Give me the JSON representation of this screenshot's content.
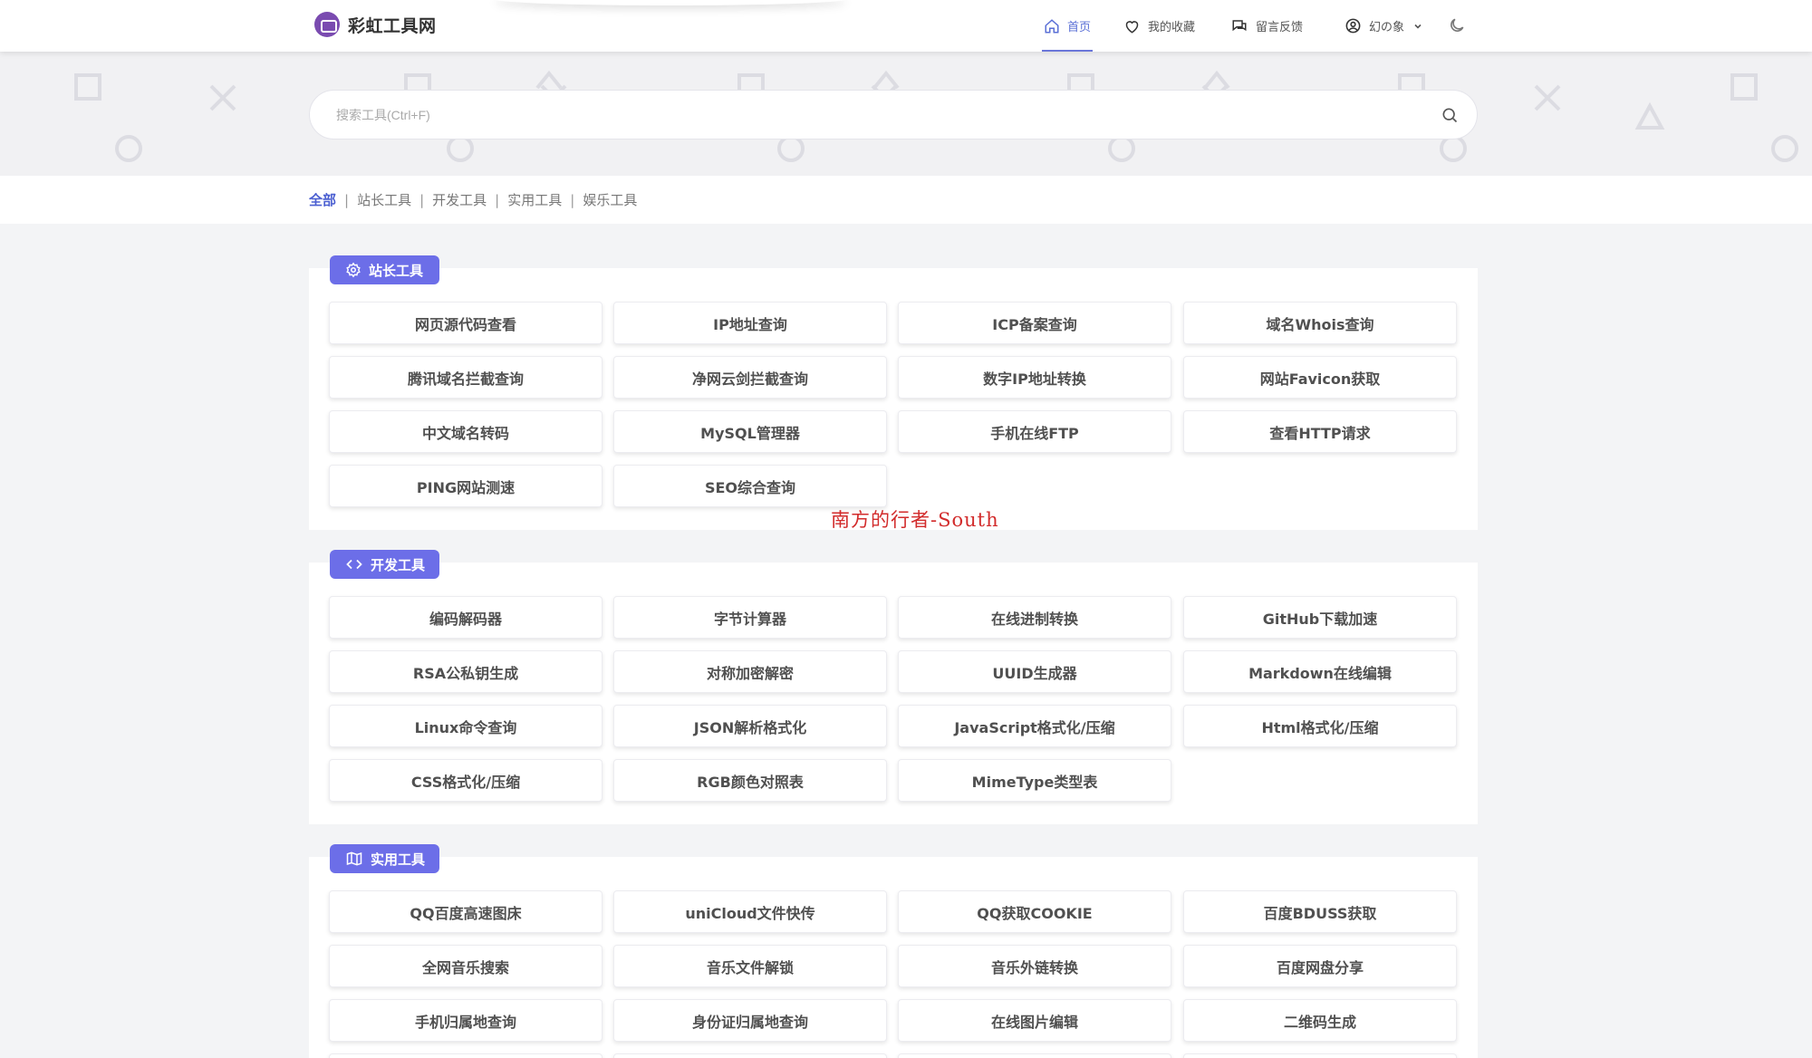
{
  "header": {
    "logo_text": "彩虹工具网",
    "nav": {
      "home": "首页",
      "favorites": "我的收藏",
      "feedback": "留言反馈",
      "user": "幻の象"
    }
  },
  "search": {
    "placeholder": "搜索工具(Ctrl+F)",
    "value": ""
  },
  "categories": [
    "全部",
    "站长工具",
    "开发工具",
    "实用工具",
    "娱乐工具"
  ],
  "sections": [
    {
      "title": "站长工具",
      "icon": "gear-icon",
      "tools": [
        "网页源代码查看",
        "IP地址查询",
        "ICP备案查询",
        "域名Whois查询",
        "腾讯域名拦截查询",
        "净网云剑拦截查询",
        "数字IP地址转换",
        "网站Favicon获取",
        "中文域名转码",
        "MySQL管理器",
        "手机在线FTP",
        "查看HTTP请求",
        "PING网站测速",
        "SEO综合查询"
      ]
    },
    {
      "title": "开发工具",
      "icon": "code-icon",
      "tools": [
        "编码解码器",
        "字节计算器",
        "在线进制转换",
        "GitHub下载加速",
        "RSA公私钥生成",
        "对称加密解密",
        "UUID生成器",
        "Markdown在线编辑",
        "Linux命令查询",
        "JSON解析格式化",
        "JavaScript格式化/压缩",
        "Html格式化/压缩",
        "CSS格式化/压缩",
        "RGB颜色对照表",
        "MimeType类型表"
      ]
    },
    {
      "title": "实用工具",
      "icon": "map-icon",
      "tools": [
        "QQ百度高速图床",
        "uniCloud文件快传",
        "QQ获取COOKIE",
        "百度BDUSS获取",
        "全网音乐搜索",
        "音乐文件解锁",
        "音乐外链转换",
        "百度网盘分享",
        "手机归属地查询",
        "身份证归属地查询",
        "在线图片编辑",
        "二维码生成"
      ]
    }
  ],
  "watermark": "南方的行者-South",
  "colors": {
    "accent": "#6c6ee8",
    "active_link": "#4b5fd1",
    "watermark": "#d22b2b"
  }
}
